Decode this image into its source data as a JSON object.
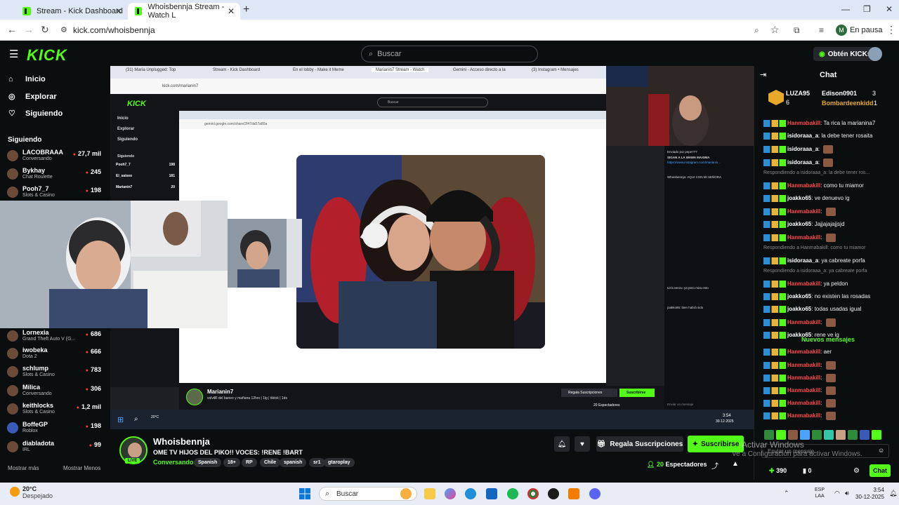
{
  "browser": {
    "tabs": [
      {
        "title": "Stream - Kick Dashboard"
      },
      {
        "title": "Whoisbennja Stream - Watch L"
      }
    ],
    "url": "kick.com/whoisbennja",
    "profile_initial": "M",
    "profile_status": "En pausa"
  },
  "header": {
    "logo": "KICK",
    "search_placeholder": "Buscar",
    "get_kicks": "Obtén KICKs"
  },
  "sidebar": {
    "nav": [
      {
        "label": "Inicio"
      },
      {
        "label": "Explorar"
      },
      {
        "label": "Siguiendo"
      }
    ],
    "following_header": "Siguiendo",
    "following": [
      {
        "name": "LACOBRAAA",
        "category": "Conversando",
        "viewers": "27,7 mil"
      },
      {
        "name": "Bykhay",
        "category": "Chat Roulette",
        "viewers": "245"
      },
      {
        "name": "Pooh7_7",
        "category": "Slots & Casino",
        "viewers": "198"
      },
      {
        "name": "Lornexia",
        "category": "Grand Theft Auto V (G...",
        "viewers": "686"
      },
      {
        "name": "iwobeka",
        "category": "Dota 2",
        "viewers": "666"
      },
      {
        "name": "schlump",
        "category": "Slots & Casino",
        "viewers": "783"
      },
      {
        "name": "Milica",
        "category": "Conversando",
        "viewers": "306"
      },
      {
        "name": "keithlocks",
        "category": "Slots & Casino",
        "viewers": "1,2 mil"
      },
      {
        "name": "BoffeGP",
        "category": "Roblox",
        "viewers": "198"
      },
      {
        "name": "diabladota",
        "category": "IRL",
        "viewers": "99"
      }
    ],
    "show_more": "Mostrar más",
    "show_less": "Mostrar Menos"
  },
  "video": {
    "inner_tabs": [
      "(31) María Unplugged: Top",
      "Stream - Kick Dashboard",
      "En el lobby - Make it Meme",
      "Marianin7 Stream - Watch",
      "Gemini - Acceso directo a la",
      "(3) Instagram • Mensajes"
    ],
    "inner_url": "kick.com/marianin7",
    "inner_search": "Buscar",
    "inner_nav": [
      "Inicio",
      "Explorar",
      "Siguiendo"
    ],
    "inner_following_header": "Siguiendo",
    "inner_following": [
      {
        "name": "Pooh7_7",
        "viewers": "198"
      },
      {
        "name": "El_saiseo",
        "viewers": "181"
      },
      {
        "name": "Marianin7",
        "viewers": "20"
      }
    ],
    "inner_gemini_url": "gemini.google.com/share/2f47da57a80a",
    "inner_streamer": "Marianin7",
    "inner_stream_title": "volvillll del baneo y mañana 12hrs | 1lg | ttktok | 1ds",
    "inner_gift": "Regala Suscripciones",
    "inner_sub": "Suscribirse",
    "inner_viewers": "20 Espectadores",
    "inner_chat_lines": [
      "Enviado por pepe777",
      "SIGAN A LA WAWA MAXIMA",
      "https://www.instagram.com/marianin...",
      "Whoisbennja: AQUI CON MI SEÑORA",
      "Uz3.eeezu: ya pero mira esto",
      "joakko65: bien habrá sido"
    ],
    "inner_chat_input": "Enviar un mensaje",
    "inner_watermark": "Activar Windows",
    "inner_clock": "3:54",
    "inner_date": "30-12-2025",
    "inner_weather": "20°C"
  },
  "stream": {
    "name": "Whoisbennja",
    "live_label": "LIVE",
    "title": "OME TV HIJOS DEL PIKO!! VOCES: !RENE !BART",
    "category": "Conversando",
    "tags": [
      "Spanish",
      "18+",
      "RP",
      "Chile",
      "spanish",
      "sr1",
      "gtaroplay"
    ],
    "gift_label": "Regala Suscripciones",
    "subscribe_label": "Suscribirse",
    "viewers_count": "20",
    "viewers_label": "Espectadores",
    "watermark_line1": "Activar Windows",
    "watermark_line2": "Ve a Configuración para activar Windows."
  },
  "chat": {
    "title": "Chat",
    "gifters": [
      {
        "name": "LUZA95",
        "count": "6"
      },
      {
        "name": "Edison0901",
        "count": "3"
      },
      {
        "name": "Bombardeenkidd",
        "count": "1"
      }
    ],
    "messages": [
      {
        "user": "Hanmabakill",
        "text": "Ta rica la marianina7",
        "color": "red"
      },
      {
        "user": "isidoraaa_a",
        "text": "la debe tener rosaita",
        "color": "white"
      },
      {
        "user": "isidoraaa_a",
        "text": "",
        "color": "white",
        "emote": true
      },
      {
        "user": "isidoraaa_a",
        "text": "",
        "color": "white",
        "emote": true
      },
      {
        "reply": "Respondiendo a isidoraaa_a: la debe tener ros..."
      },
      {
        "user": "Hanmabakill",
        "text": "como tu miamor",
        "color": "red"
      },
      {
        "user": "joakko65",
        "text": "ve denuevo ig",
        "color": "white"
      },
      {
        "user": "Hanmabakill",
        "text": "",
        "color": "red",
        "emote": true
      },
      {
        "user": "joakko65",
        "text": "Jajjajajajjsjd",
        "color": "white"
      },
      {
        "user": "Hanmabakill",
        "text": "",
        "color": "red",
        "emote": true
      },
      {
        "reply": "Respondiendo a Hanmabakill: como tu miamor"
      },
      {
        "user": "isidoraaa_a",
        "text": "ya cabreate porfa",
        "color": "white"
      },
      {
        "reply": "Respondiendo a isidoraaa_a: ya cabreate porfa"
      },
      {
        "user": "Hanmabakill",
        "text": "ya peldon",
        "color": "red"
      },
      {
        "user": "joakko65",
        "text": "no existen las rosadas",
        "color": "white"
      },
      {
        "user": "joakko65",
        "text": "todas usadas igual",
        "color": "white"
      },
      {
        "user": "Hanmabakill",
        "text": "",
        "color": "red",
        "emote": true
      },
      {
        "user": "joakko65",
        "text": "rene ve ig",
        "color": "white"
      }
    ],
    "new_messages": "Nuevos mensajes",
    "new_messages_list": [
      {
        "user": "Hanmabakill",
        "text": "aer",
        "color": "red"
      },
      {
        "user": "Hanmabakill",
        "text": "",
        "color": "red",
        "emote": true
      },
      {
        "user": "Hanmabakill",
        "text": "",
        "color": "red",
        "emote": true
      },
      {
        "user": "Hanmabakill",
        "text": "",
        "color": "red",
        "emote": true
      },
      {
        "user": "Hanmabakill",
        "text": "",
        "color": "red",
        "emote": true
      },
      {
        "user": "Hanmabakill",
        "text": "",
        "color": "red",
        "emote": true
      }
    ],
    "input_placeholder": "Enviar un mensaje",
    "points": "390",
    "kicks": "0",
    "send_label": "Chat"
  },
  "taskbar": {
    "temperature": "20°C",
    "weather": "Despejado",
    "search_placeholder": "Buscar",
    "lang": "ESP",
    "lang2": "LAA",
    "time": "3:54",
    "date": "30-12-2025"
  },
  "colors": {
    "kick_green": "#53fc18",
    "background": "#0b0e0f",
    "surface": "#24272c",
    "live_red": "#ff3b3b"
  }
}
